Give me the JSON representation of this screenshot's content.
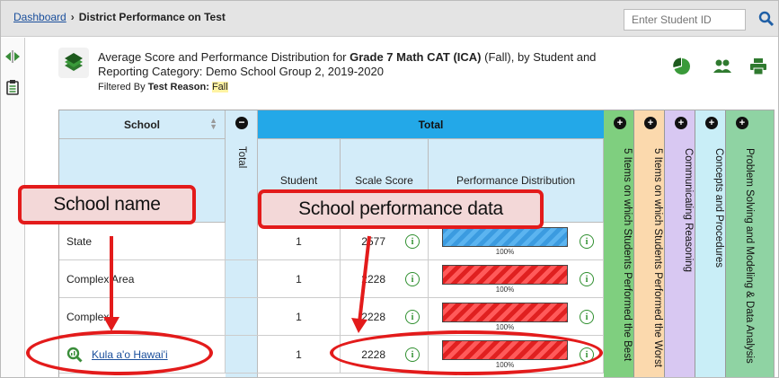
{
  "breadcrumb": {
    "home": "Dashboard",
    "separator": "›",
    "current": "District Performance on Test"
  },
  "search": {
    "placeholder": "Enter Student ID"
  },
  "report": {
    "title_pre": "Average Score and Performance Distribution for ",
    "title_bold": "Grade 7 Math CAT (ICA)",
    "title_post": " (Fall), by Student and Reporting Category: Demo School Group 2, 2019-2020",
    "filter_label": "Filtered By ",
    "filter_name": "Test Reason: ",
    "filter_value": "Fall"
  },
  "table": {
    "school_header": "School",
    "total_vertical": "Total",
    "total_header": "Total",
    "student_header": "Student",
    "scale_header": "Scale Score",
    "dist_header": "Performance Distribution",
    "categories": [
      {
        "label": "5 Items on which Students Performed the Best",
        "color": "#7fcf7f"
      },
      {
        "label": "5 Items on which Students Performed the Worst",
        "color": "#fbd9ad"
      },
      {
        "label": "Communicating Reasoning",
        "color": "#d8c8f2"
      },
      {
        "label": "Concepts and Procedures",
        "color": "#c9eef7"
      },
      {
        "label": "Problem Solving and Modeling & Data Analysis",
        "color": "#8fd3a3"
      }
    ],
    "rows": [
      {
        "name": "State",
        "students": "1",
        "score": "2577",
        "pct": "100%",
        "bar": "blue"
      },
      {
        "name": "Complex Area",
        "students": "1",
        "score": "2228",
        "pct": "100%",
        "bar": "red"
      },
      {
        "name": "Complex",
        "students": "1",
        "score": "2228",
        "pct": "100%",
        "bar": "red"
      },
      {
        "name": "Kula a'o Hawai'i",
        "students": "1",
        "score": "2228",
        "pct": "100%",
        "bar": "red"
      }
    ]
  },
  "annotations": {
    "school_name": "School name",
    "school_data": "School performance data"
  },
  "colors": {
    "accent": "#23a8e8",
    "callout_red": "#e31b1b",
    "icon_green": "#2f8f2f"
  }
}
